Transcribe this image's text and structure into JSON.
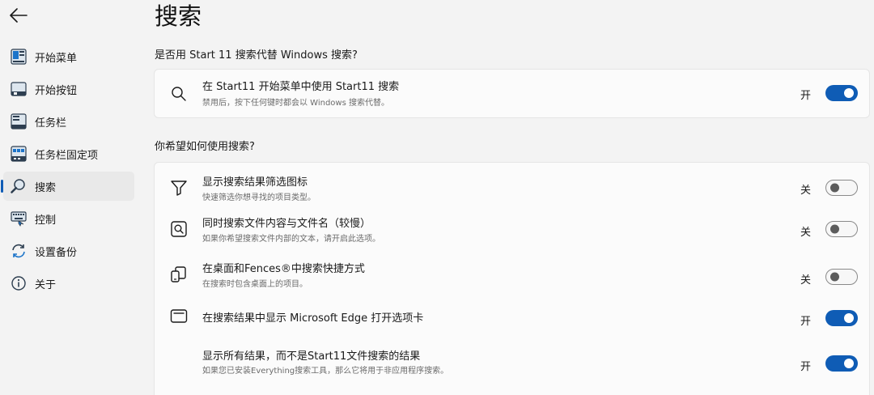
{
  "colors": {
    "accent": "#0f5cb5",
    "background": "#f3f3f3",
    "card": "#fbfbfb"
  },
  "sidebar": {
    "back_icon": "arrow-left-icon",
    "items": [
      {
        "label": "开始菜单",
        "icon": "start-menu-icon",
        "active": false
      },
      {
        "label": "开始按钮",
        "icon": "start-button-icon",
        "active": false
      },
      {
        "label": "任务栏",
        "icon": "taskbar-icon",
        "active": false
      },
      {
        "label": "任务栏固定项",
        "icon": "taskbar-pins-icon",
        "active": false
      },
      {
        "label": "搜索",
        "icon": "search-icon",
        "active": true
      },
      {
        "label": "控制",
        "icon": "keyboard-icon",
        "active": false
      },
      {
        "label": "设置备份",
        "icon": "sync-icon",
        "active": false
      },
      {
        "label": "关于",
        "icon": "info-icon",
        "active": false
      }
    ]
  },
  "main": {
    "title": "搜索",
    "section1": {
      "title": "是否用 Start 11 搜索代替 Windows 搜索?",
      "rows": [
        {
          "title": "在 Start11 开始菜单中使用 Start11 搜索",
          "subtitle": "禁用后，按下任何键时都会以 Windows 搜索代替。",
          "state": "开",
          "on": true,
          "icon": "search-icon"
        }
      ]
    },
    "section2": {
      "title": "你希望如何使用搜索?",
      "rows": [
        {
          "title": "显示搜索结果筛选图标",
          "subtitle": "快速筛选你想寻找的项目类型。",
          "state": "关",
          "on": false,
          "icon": "filter-icon"
        },
        {
          "title": "同时搜索文件内容与文件名（较慢）",
          "subtitle": "如果你希望搜索文件内部的文本，请开启此选项。",
          "state": "关",
          "on": false,
          "icon": "file-search-icon"
        },
        {
          "title": "在桌面和Fences®中搜索快捷方式",
          "subtitle": "在搜索时包含桌面上的项目。",
          "state": "关",
          "on": false,
          "icon": "desktop-shortcut-icon"
        },
        {
          "title": "在搜索结果中显示 Microsoft Edge 打开选项卡",
          "subtitle": "",
          "state": "开",
          "on": true,
          "icon": "browser-tab-icon"
        },
        {
          "title": "显示所有结果，而不是Start11文件搜索的结果",
          "subtitle": "如果您已安装Everything搜索工具，那么它将用于非应用程序搜索。",
          "state": "开",
          "on": true,
          "icon": ""
        }
      ]
    }
  }
}
